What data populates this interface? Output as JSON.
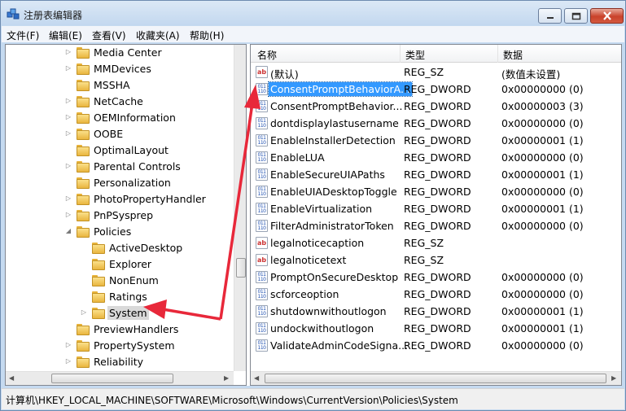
{
  "window": {
    "title": "注册表编辑器"
  },
  "menu": [
    "文件(F)",
    "编辑(E)",
    "查看(V)",
    "收藏夹(A)",
    "帮助(H)"
  ],
  "tree": {
    "items": [
      {
        "label": "Media Center",
        "expander": "▷",
        "indent": 0
      },
      {
        "label": "MMDevices",
        "expander": "▷",
        "indent": 0
      },
      {
        "label": "MSSHA",
        "expander": "",
        "indent": 0
      },
      {
        "label": "NetCache",
        "expander": "▷",
        "indent": 0
      },
      {
        "label": "OEMInformation",
        "expander": "▷",
        "indent": 0
      },
      {
        "label": "OOBE",
        "expander": "▷",
        "indent": 0
      },
      {
        "label": "OptimalLayout",
        "expander": "",
        "indent": 0
      },
      {
        "label": "Parental Controls",
        "expander": "▷",
        "indent": 0
      },
      {
        "label": "Personalization",
        "expander": "",
        "indent": 0
      },
      {
        "label": "PhotoPropertyHandler",
        "expander": "▷",
        "indent": 0
      },
      {
        "label": "PnPSysprep",
        "expander": "▷",
        "indent": 0
      },
      {
        "label": "Policies",
        "expander": "◢",
        "indent": 0
      },
      {
        "label": "ActiveDesktop",
        "expander": "",
        "indent": 1
      },
      {
        "label": "Explorer",
        "expander": "",
        "indent": 1
      },
      {
        "label": "NonEnum",
        "expander": "",
        "indent": 1
      },
      {
        "label": "Ratings",
        "expander": "",
        "indent": 1
      },
      {
        "label": "System",
        "expander": "▷",
        "indent": 1,
        "selected": true
      },
      {
        "label": "PreviewHandlers",
        "expander": "",
        "indent": 0
      },
      {
        "label": "PropertySystem",
        "expander": "▷",
        "indent": 0
      },
      {
        "label": "Reliability",
        "expander": "▷",
        "indent": 0
      }
    ]
  },
  "list": {
    "headers": {
      "name": "名称",
      "type": "类型",
      "data": "数据"
    },
    "rows": [
      {
        "icon": "sz",
        "name": "(默认)",
        "type": "REG_SZ",
        "data": "(数值未设置)"
      },
      {
        "icon": "dw",
        "name": "ConsentPromptBehaviorA...",
        "type": "REG_DWORD",
        "data": "0x00000000 (0)",
        "selected": true
      },
      {
        "icon": "dw",
        "name": "ConsentPromptBehavior...",
        "type": "REG_DWORD",
        "data": "0x00000003 (3)"
      },
      {
        "icon": "dw",
        "name": "dontdisplaylastusername",
        "type": "REG_DWORD",
        "data": "0x00000000 (0)"
      },
      {
        "icon": "dw",
        "name": "EnableInstallerDetection",
        "type": "REG_DWORD",
        "data": "0x00000001 (1)"
      },
      {
        "icon": "dw",
        "name": "EnableLUA",
        "type": "REG_DWORD",
        "data": "0x00000000 (0)"
      },
      {
        "icon": "dw",
        "name": "EnableSecureUIAPaths",
        "type": "REG_DWORD",
        "data": "0x00000001 (1)"
      },
      {
        "icon": "dw",
        "name": "EnableUIADesktopToggle",
        "type": "REG_DWORD",
        "data": "0x00000000 (0)"
      },
      {
        "icon": "dw",
        "name": "EnableVirtualization",
        "type": "REG_DWORD",
        "data": "0x00000001 (1)"
      },
      {
        "icon": "dw",
        "name": "FilterAdministratorToken",
        "type": "REG_DWORD",
        "data": "0x00000000 (0)"
      },
      {
        "icon": "sz",
        "name": "legalnoticecaption",
        "type": "REG_SZ",
        "data": ""
      },
      {
        "icon": "sz",
        "name": "legalnoticetext",
        "type": "REG_SZ",
        "data": ""
      },
      {
        "icon": "dw",
        "name": "PromptOnSecureDesktop",
        "type": "REG_DWORD",
        "data": "0x00000000 (0)"
      },
      {
        "icon": "dw",
        "name": "scforceoption",
        "type": "REG_DWORD",
        "data": "0x00000000 (0)"
      },
      {
        "icon": "dw",
        "name": "shutdownwithoutlogon",
        "type": "REG_DWORD",
        "data": "0x00000001 (1)"
      },
      {
        "icon": "dw",
        "name": "undockwithoutlogon",
        "type": "REG_DWORD",
        "data": "0x00000001 (1)"
      },
      {
        "icon": "dw",
        "name": "ValidateAdminCodeSigna...",
        "type": "REG_DWORD",
        "data": "0x00000000 (0)"
      }
    ]
  },
  "status": {
    "path": "计算机\\HKEY_LOCAL_MACHINE\\SOFTWARE\\Microsoft\\Windows\\CurrentVersion\\Policies\\System"
  },
  "colors": {
    "annotation_arrow": "#e8283a",
    "selection": "#3399ff"
  },
  "icons": {
    "string_value": "ab-icon",
    "dword_value": "binary-icon",
    "folder": "folder-icon"
  }
}
